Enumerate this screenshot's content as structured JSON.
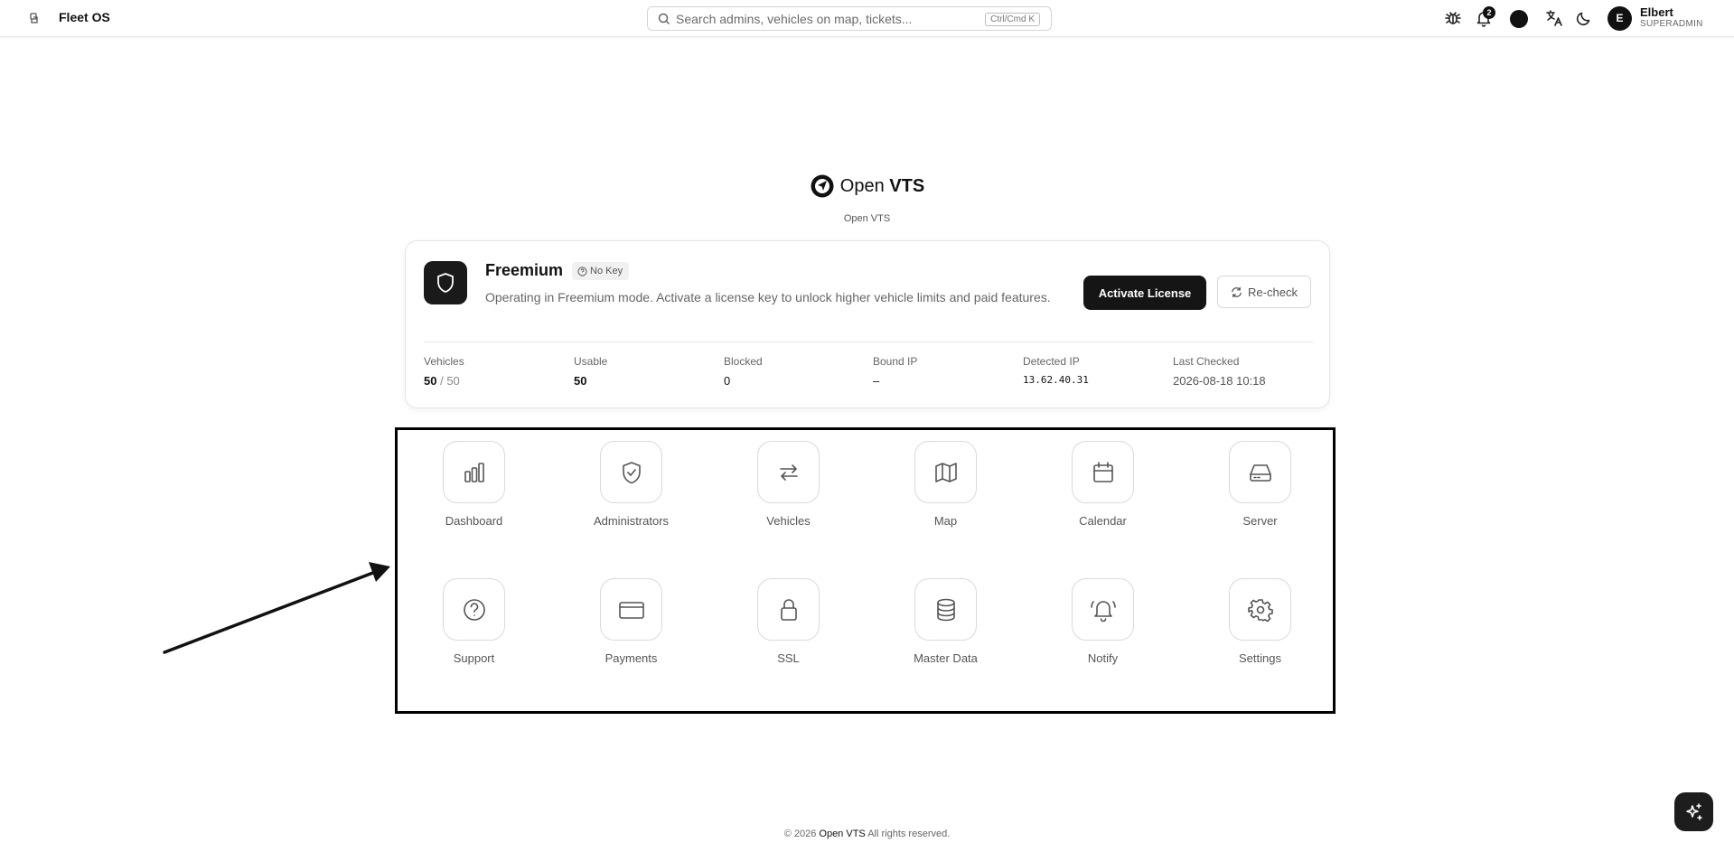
{
  "app": {
    "title": "Fleet OS"
  },
  "search": {
    "placeholder": "Search admins, vehicles on map, tickets...",
    "shortcut": "Ctrl/Cmd K"
  },
  "topbar": {
    "icons": [
      "bug-icon",
      "bell-icon",
      "status-dot",
      "translate-icon",
      "moon-icon"
    ],
    "notification_count": "2",
    "user": {
      "initial": "E",
      "name": "Elbert",
      "role": "SUPERADMIN"
    }
  },
  "brand": {
    "name_light": "Open ",
    "name_bold": "VTS",
    "subtitle": "Open VTS"
  },
  "license": {
    "tier": "Freemium",
    "badge": "No Key",
    "description": "Operating in Freemium mode. Activate a license key to unlock higher vehicle limits and paid features.",
    "activate_label": "Activate License",
    "recheck_label": "Re-check",
    "stats": {
      "vehicles": {
        "label": "Vehicles",
        "used": "50",
        "sep": " / ",
        "total": "50"
      },
      "usable": {
        "label": "Usable",
        "value": "50"
      },
      "blocked": {
        "label": "Blocked",
        "value": "0"
      },
      "bound_ip": {
        "label": "Bound IP",
        "value": "–"
      },
      "detected_ip": {
        "label": "Detected IP",
        "value": "13.62.40.31"
      },
      "last_checked": {
        "label": "Last Checked",
        "value": "2026-08-18 10:18"
      }
    }
  },
  "tiles": [
    {
      "label": "Dashboard",
      "icon": "chart-bars-icon"
    },
    {
      "label": "Administrators",
      "icon": "shield-check-icon"
    },
    {
      "label": "Vehicles",
      "icon": "arrows-swap-icon"
    },
    {
      "label": "Map",
      "icon": "map-icon"
    },
    {
      "label": "Calendar",
      "icon": "calendar-icon"
    },
    {
      "label": "Server",
      "icon": "hard-drive-icon"
    },
    {
      "label": "Support",
      "icon": "help-circle-icon"
    },
    {
      "label": "Payments",
      "icon": "credit-card-icon"
    },
    {
      "label": "SSL",
      "icon": "lock-icon"
    },
    {
      "label": "Master Data",
      "icon": "database-icon"
    },
    {
      "label": "Notify",
      "icon": "bell-ring-icon"
    },
    {
      "label": "Settings",
      "icon": "gear-icon"
    }
  ],
  "footer": {
    "prefix": "© 2026 ",
    "brand": "Open VTS",
    "suffix": " All rights reserved."
  }
}
